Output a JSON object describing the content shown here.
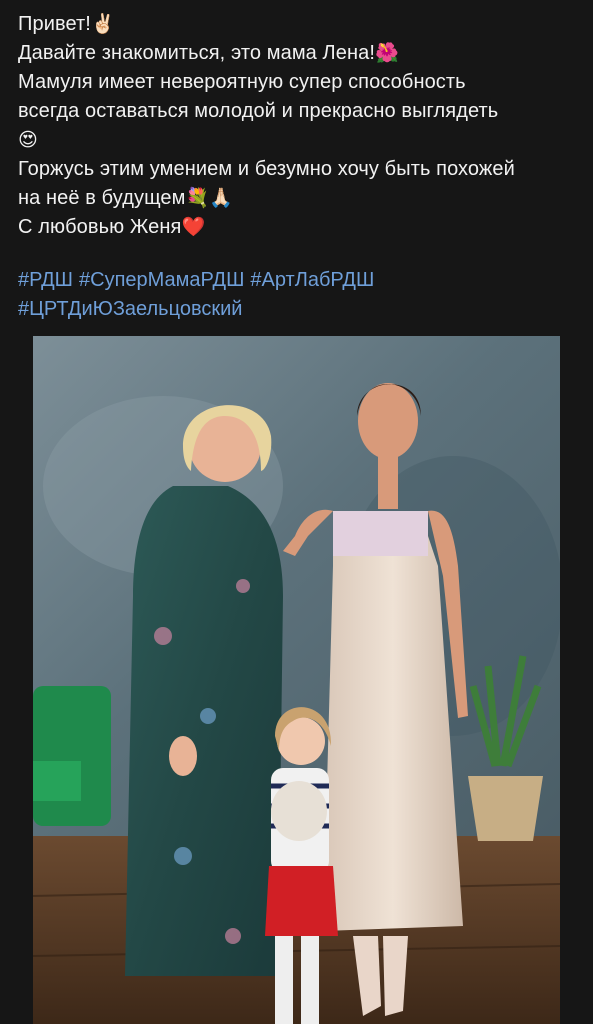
{
  "post": {
    "lines": [
      {
        "text": "Привет!",
        "emoji": "✌🏻"
      },
      {
        "text": "Давайте знакомиться, это мама Лена!",
        "emoji": "🌺"
      },
      {
        "text": "Мамуля имеет невероятную супер способность",
        "emoji": ""
      },
      {
        "text": "всегда оставаться молодой и прекрасно выглядеть",
        "emoji": ""
      },
      {
        "text": "",
        "emoji": "😍"
      },
      {
        "text": "Горжусь этим умением и безумно хочу быть похожей",
        "emoji": ""
      },
      {
        "text": "на неё в будущем",
        "emoji": "💐🙏🏻"
      },
      {
        "text": "С любовью Женя",
        "emoji": "❤️"
      }
    ],
    "hashtags_line1": [
      "#РДШ",
      "#СуперМамаРДШ",
      "#АртЛабРДШ"
    ],
    "hashtags_line2": [
      "#ЦРТДиЮЗаельцовский"
    ]
  },
  "colors": {
    "background": "#161616",
    "text": "#f2f2f2",
    "hashtag": "#6f9fd9"
  }
}
